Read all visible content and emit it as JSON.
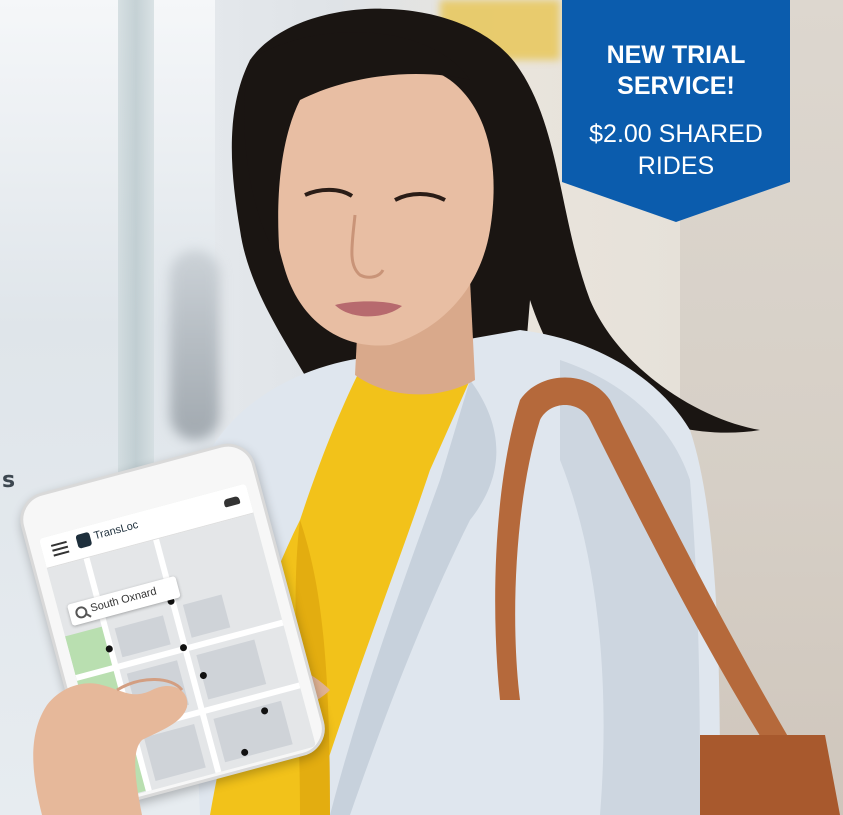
{
  "banner": {
    "line1": "NEW TRIAL",
    "line2": "SERVICE!",
    "line3": "$2.00 SHARED",
    "line4": "RIDES",
    "color": "#0b5cad"
  },
  "left_text": {
    "fragment": "s"
  },
  "phone": {
    "app_name": "TransLoc",
    "search_value": "South Oxnard",
    "menu_icon": "hamburger-menu-icon",
    "vehicle_icon": "car-icon",
    "search_icon": "search-icon"
  },
  "colors": {
    "blouse": "#f2c21a",
    "jacket": "#dfe6ee",
    "bag_strap": "#b5693b"
  }
}
